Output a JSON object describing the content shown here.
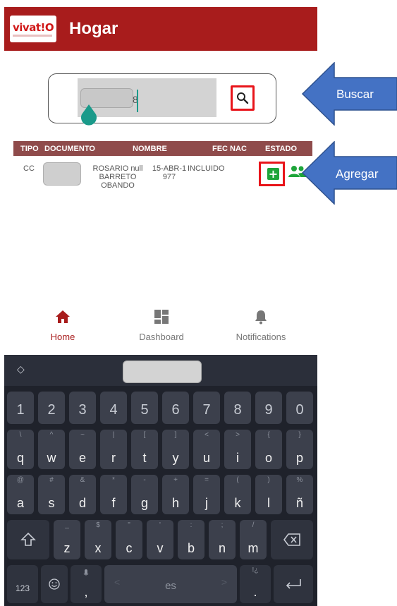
{
  "app": {
    "logo_text": "vivat!O",
    "title": "Hogar"
  },
  "search": {
    "value": "8",
    "button": "search-icon"
  },
  "table": {
    "headers": [
      "TIPO",
      "DOCUMENTO",
      "NOMBRE",
      "FEC NAC",
      "ESTADO"
    ],
    "rows": [
      {
        "tipo": "CC",
        "nombre": "ROSARIO null BARRETO OBANDO",
        "fec_nac": "15-ABR-1977",
        "estado": "INCLUIDO"
      }
    ],
    "add_label": "+"
  },
  "nav": {
    "home": "Home",
    "dashboard": "Dashboard",
    "notifications": "Notifications"
  },
  "keyboard": {
    "numbers": [
      "1",
      "2",
      "3",
      "4",
      "5",
      "6",
      "7",
      "8",
      "9",
      "0"
    ],
    "row1": [
      {
        "k": "q",
        "s": "\\"
      },
      {
        "k": "w",
        "s": "^"
      },
      {
        "k": "e",
        "s": "~"
      },
      {
        "k": "r",
        "s": "|"
      },
      {
        "k": "t",
        "s": "["
      },
      {
        "k": "y",
        "s": "]"
      },
      {
        "k": "u",
        "s": "<"
      },
      {
        "k": "i",
        "s": ">"
      },
      {
        "k": "o",
        "s": "{"
      },
      {
        "k": "p",
        "s": "}"
      }
    ],
    "row2": [
      {
        "k": "a",
        "s": "@"
      },
      {
        "k": "s",
        "s": "#"
      },
      {
        "k": "d",
        "s": "&"
      },
      {
        "k": "f",
        "s": "*"
      },
      {
        "k": "g",
        "s": "-"
      },
      {
        "k": "h",
        "s": "+"
      },
      {
        "k": "j",
        "s": "="
      },
      {
        "k": "k",
        "s": "("
      },
      {
        "k": "l",
        "s": ")"
      },
      {
        "k": "ñ",
        "s": "%"
      }
    ],
    "row3": [
      {
        "k": "z",
        "s": "_"
      },
      {
        "k": "x",
        "s": "$"
      },
      {
        "k": "c",
        "s": "\""
      },
      {
        "k": "v",
        "s": "'"
      },
      {
        "k": "b",
        "s": ":"
      },
      {
        "k": "n",
        "s": ";"
      },
      {
        "k": "m",
        "s": "/"
      }
    ],
    "sym_label": "123",
    "space_label": "es",
    "comma": ",",
    "period": ".",
    "period_sub": "!¿"
  },
  "callouts": {
    "buscar": "Buscar",
    "agregar": "Agregar"
  },
  "colors": {
    "brand": "#a81c1c",
    "highlight": "#e8141a",
    "callout": "#4472c4",
    "add_green": "#1ea53a"
  }
}
